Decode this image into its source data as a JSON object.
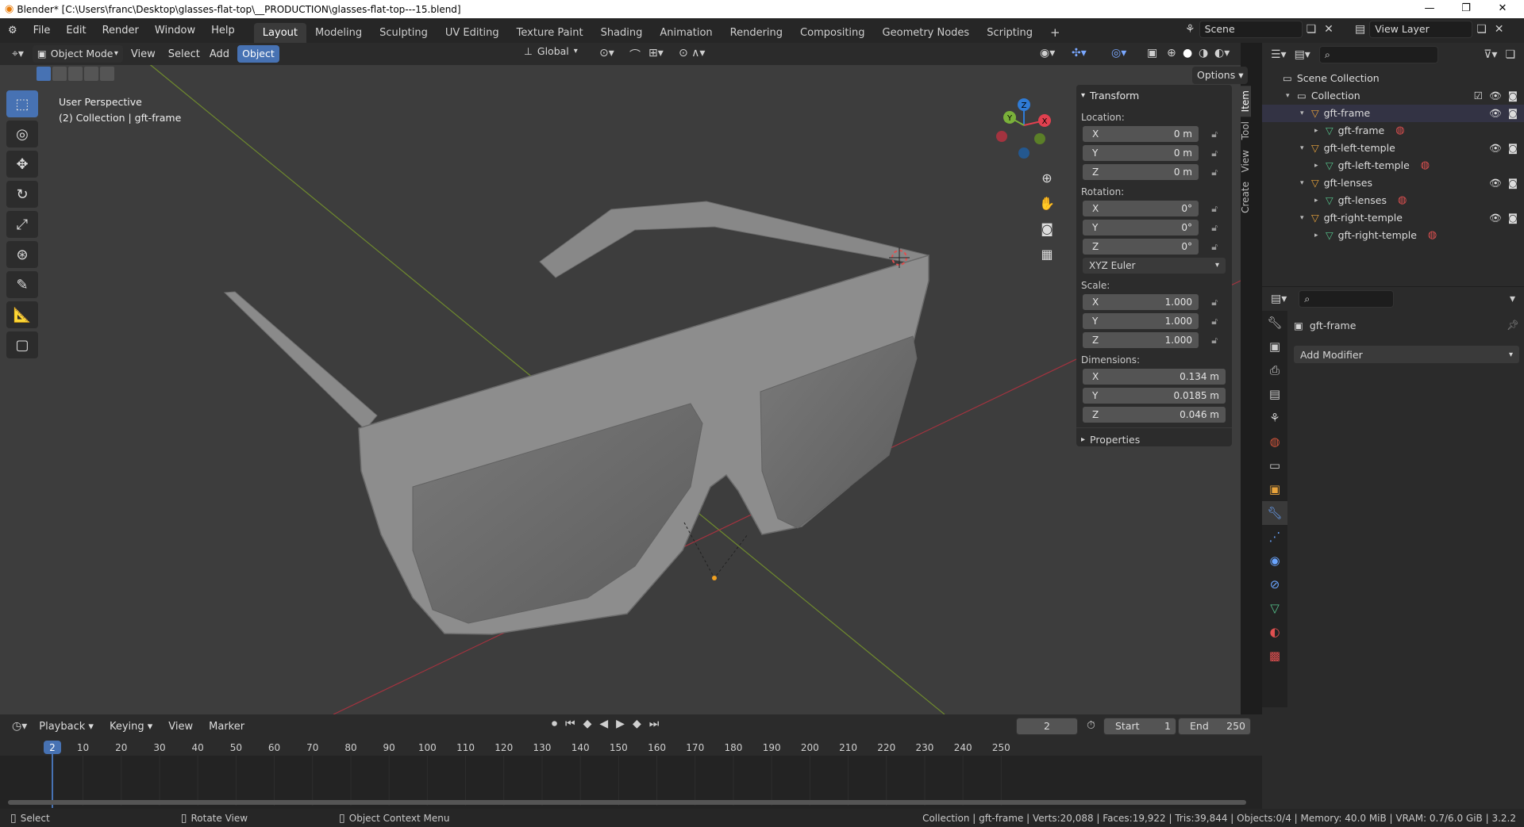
{
  "window": {
    "title": "Blender* [C:\\Users\\franc\\Desktop\\glasses-flat-top\\__PRODUCTION\\glasses-flat-top---15.blend]",
    "controls": [
      "—",
      "❐",
      "✕"
    ]
  },
  "menu": [
    "File",
    "Edit",
    "Render",
    "Window",
    "Help"
  ],
  "workspaces": [
    "Layout",
    "Modeling",
    "Sculpting",
    "UV Editing",
    "Texture Paint",
    "Shading",
    "Animation",
    "Rendering",
    "Compositing",
    "Geometry Nodes",
    "Scripting"
  ],
  "active_workspace": "Layout",
  "scene_label": "Scene",
  "view_layer_label": "View Layer",
  "viewport": {
    "mode": "Object Mode",
    "menus": [
      "View",
      "Select",
      "Add",
      "Object"
    ],
    "active_menu": "Object",
    "orientation": "Global",
    "options_label": "Options",
    "overlay_line1": "User Perspective",
    "overlay_line2": "(2) Collection | gft-frame",
    "gizmo": {
      "x": "X",
      "y": "Y",
      "z": "Z"
    }
  },
  "npanel": {
    "tabs": [
      "Item",
      "Tool",
      "View",
      "Create"
    ],
    "section": "Transform",
    "location_label": "Location:",
    "location": [
      {
        "axis": "X",
        "value": "0 m"
      },
      {
        "axis": "Y",
        "value": "0 m"
      },
      {
        "axis": "Z",
        "value": "0 m"
      }
    ],
    "rotation_label": "Rotation:",
    "rotation": [
      {
        "axis": "X",
        "value": "0°"
      },
      {
        "axis": "Y",
        "value": "0°"
      },
      {
        "axis": "Z",
        "value": "0°"
      }
    ],
    "rotation_mode": "XYZ Euler",
    "scale_label": "Scale:",
    "scale": [
      {
        "axis": "X",
        "value": "1.000"
      },
      {
        "axis": "Y",
        "value": "1.000"
      },
      {
        "axis": "Z",
        "value": "1.000"
      }
    ],
    "dimensions_label": "Dimensions:",
    "dimensions": [
      {
        "axis": "X",
        "value": "0.134 m"
      },
      {
        "axis": "Y",
        "value": "0.0185 m"
      },
      {
        "axis": "Z",
        "value": "0.046 m"
      }
    ],
    "properties_label": "Properties"
  },
  "outliner": {
    "rows": [
      {
        "label": "Scene Collection",
        "level": 0,
        "icon": "scene-collection-icon"
      },
      {
        "label": "Collection",
        "level": 1,
        "icon": "collection-icon",
        "check": true
      },
      {
        "label": "gft-frame",
        "level": 2,
        "icon": "object-icon",
        "vis": true
      },
      {
        "label": "gft-frame",
        "level": 3,
        "icon": "mesh-data-icon",
        "mat": true
      },
      {
        "label": "gft-left-temple",
        "level": 2,
        "icon": "object-icon",
        "vis": true
      },
      {
        "label": "gft-left-temple",
        "level": 3,
        "icon": "mesh-data-icon",
        "mat": true
      },
      {
        "label": "gft-lenses",
        "level": 2,
        "icon": "object-icon",
        "vis": true
      },
      {
        "label": "gft-lenses",
        "level": 3,
        "icon": "mesh-data-icon",
        "mat": true
      },
      {
        "label": "gft-right-temple",
        "level": 2,
        "icon": "object-icon",
        "vis": true
      },
      {
        "label": "gft-right-temple",
        "level": 3,
        "icon": "mesh-data-icon",
        "mat": true
      }
    ]
  },
  "properties": {
    "object_name": "gft-frame",
    "add_modifier": "Add Modifier"
  },
  "timeline": {
    "menus": [
      "Playback",
      "Keying",
      "View",
      "Marker"
    ],
    "current_frame": "2",
    "start_label": "Start",
    "start": "1",
    "end_label": "End",
    "end": "250",
    "ruler": [
      "10",
      "20",
      "30",
      "40",
      "50",
      "60",
      "70",
      "80",
      "90",
      "100",
      "110",
      "120",
      "130",
      "140",
      "150",
      "160",
      "170",
      "180",
      "190",
      "200",
      "210",
      "220",
      "230",
      "240",
      "250"
    ]
  },
  "status": {
    "select": "Select",
    "rotate": "Rotate View",
    "context": "Object Context Menu",
    "stats": "Collection | gft-frame | Verts:20,088 | Faces:19,922 | Tris:39,844 | Objects:0/4 | Memory: 40.0 MiB | VRAM: 0.7/6.0 GiB | 3.2.2"
  },
  "colors": {
    "accent": "#4772b3",
    "x_axis": "#e0404f",
    "y_axis": "#7ab13a",
    "z_axis": "#2f7bd6",
    "object_orange": "#e8a33b",
    "mesh_green": "#55c28b"
  }
}
